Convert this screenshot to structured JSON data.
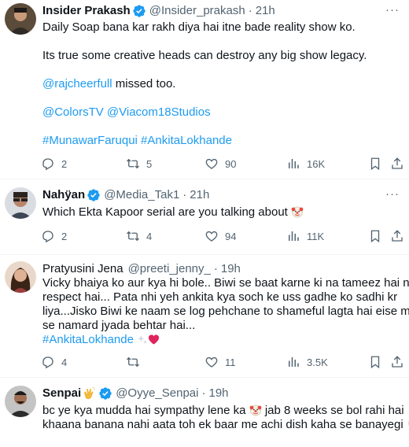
{
  "tweets": [
    {
      "display_name": "Insider Prakash",
      "handle": "@Insider_prakash",
      "separator": "·",
      "time": "21h",
      "more": "···",
      "lines": [
        "Daily Soap bana kar rakh diya hai itne bade reality show ko.",
        "Its true some creative heads can destroy any big show legacy.",
        "@rajcheerfull",
        " missed too.",
        "@ColorsTV @Viacom18Studios",
        "#MunawarFaruqui #AnkitaLokhande"
      ],
      "replies": "2",
      "reposts": "5",
      "likes": "90",
      "views": "16K"
    },
    {
      "display_name": "Nahÿan",
      "handle": "@Media_Tak1",
      "separator": "·",
      "time": "21h",
      "more": "···",
      "lines": [
        "Which Ekta Kapoor serial are you talking about"
      ],
      "replies": "2",
      "reposts": "4",
      "likes": "94",
      "views": "11K"
    },
    {
      "display_name": "Pratyusini Jena",
      "handle": "@preeti_jenny_",
      "separator": "·",
      "time": "19h",
      "lines": [
        "Vicky bhaiya ko aur kya hi bole.. Biwi se baat karne ki na tameez hai na",
        "respect hai... Pata nhi yeh ankita kya soch ke uss gadhe ko sadhi kr",
        "liya...Jisko Biwi ke naam se log pehchane to shameful lagta hai eise mard",
        "se namard jyada behtar hai...",
        "#AnkitaLokhande"
      ],
      "replies": "4",
      "reposts": "",
      "likes": "11",
      "views": "3.5K"
    },
    {
      "display_name": "Senpai",
      "handle": "@Oyye_Senpai",
      "separator": "·",
      "time": "19h",
      "lines": [
        "bc ye kya mudda hai sympathy lene ka",
        " jab 8 weeks se bol rahi hai",
        "khaana banana nahi aata toh ek baar me achi dish kaha se banayegi"
      ]
    }
  ],
  "colors": {
    "link": "#1d9bf0",
    "verified": "#1d9bf0",
    "muted": "#536471",
    "heart": "#e0245e"
  }
}
